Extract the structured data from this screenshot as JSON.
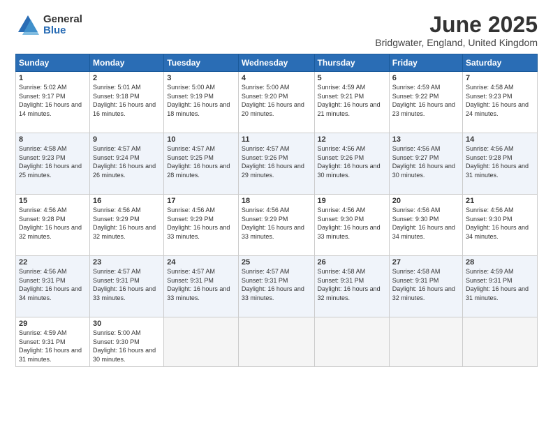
{
  "logo": {
    "general": "General",
    "blue": "Blue"
  },
  "title": "June 2025",
  "location": "Bridgwater, England, United Kingdom",
  "days_header": [
    "Sunday",
    "Monday",
    "Tuesday",
    "Wednesday",
    "Thursday",
    "Friday",
    "Saturday"
  ],
  "weeks": [
    [
      {
        "num": "1",
        "sunrise": "5:02 AM",
        "sunset": "9:17 PM",
        "daylight": "16 hours and 14 minutes."
      },
      {
        "num": "2",
        "sunrise": "5:01 AM",
        "sunset": "9:18 PM",
        "daylight": "16 hours and 16 minutes."
      },
      {
        "num": "3",
        "sunrise": "5:00 AM",
        "sunset": "9:19 PM",
        "daylight": "16 hours and 18 minutes."
      },
      {
        "num": "4",
        "sunrise": "5:00 AM",
        "sunset": "9:20 PM",
        "daylight": "16 hours and 20 minutes."
      },
      {
        "num": "5",
        "sunrise": "4:59 AM",
        "sunset": "9:21 PM",
        "daylight": "16 hours and 21 minutes."
      },
      {
        "num": "6",
        "sunrise": "4:59 AM",
        "sunset": "9:22 PM",
        "daylight": "16 hours and 23 minutes."
      },
      {
        "num": "7",
        "sunrise": "4:58 AM",
        "sunset": "9:23 PM",
        "daylight": "16 hours and 24 minutes."
      }
    ],
    [
      {
        "num": "8",
        "sunrise": "4:58 AM",
        "sunset": "9:23 PM",
        "daylight": "16 hours and 25 minutes."
      },
      {
        "num": "9",
        "sunrise": "4:57 AM",
        "sunset": "9:24 PM",
        "daylight": "16 hours and 26 minutes."
      },
      {
        "num": "10",
        "sunrise": "4:57 AM",
        "sunset": "9:25 PM",
        "daylight": "16 hours and 28 minutes."
      },
      {
        "num": "11",
        "sunrise": "4:57 AM",
        "sunset": "9:26 PM",
        "daylight": "16 hours and 29 minutes."
      },
      {
        "num": "12",
        "sunrise": "4:56 AM",
        "sunset": "9:26 PM",
        "daylight": "16 hours and 30 minutes."
      },
      {
        "num": "13",
        "sunrise": "4:56 AM",
        "sunset": "9:27 PM",
        "daylight": "16 hours and 30 minutes."
      },
      {
        "num": "14",
        "sunrise": "4:56 AM",
        "sunset": "9:28 PM",
        "daylight": "16 hours and 31 minutes."
      }
    ],
    [
      {
        "num": "15",
        "sunrise": "4:56 AM",
        "sunset": "9:28 PM",
        "daylight": "16 hours and 32 minutes."
      },
      {
        "num": "16",
        "sunrise": "4:56 AM",
        "sunset": "9:29 PM",
        "daylight": "16 hours and 32 minutes."
      },
      {
        "num": "17",
        "sunrise": "4:56 AM",
        "sunset": "9:29 PM",
        "daylight": "16 hours and 33 minutes."
      },
      {
        "num": "18",
        "sunrise": "4:56 AM",
        "sunset": "9:29 PM",
        "daylight": "16 hours and 33 minutes."
      },
      {
        "num": "19",
        "sunrise": "4:56 AM",
        "sunset": "9:30 PM",
        "daylight": "16 hours and 33 minutes."
      },
      {
        "num": "20",
        "sunrise": "4:56 AM",
        "sunset": "9:30 PM",
        "daylight": "16 hours and 34 minutes."
      },
      {
        "num": "21",
        "sunrise": "4:56 AM",
        "sunset": "9:30 PM",
        "daylight": "16 hours and 34 minutes."
      }
    ],
    [
      {
        "num": "22",
        "sunrise": "4:56 AM",
        "sunset": "9:31 PM",
        "daylight": "16 hours and 34 minutes."
      },
      {
        "num": "23",
        "sunrise": "4:57 AM",
        "sunset": "9:31 PM",
        "daylight": "16 hours and 33 minutes."
      },
      {
        "num": "24",
        "sunrise": "4:57 AM",
        "sunset": "9:31 PM",
        "daylight": "16 hours and 33 minutes."
      },
      {
        "num": "25",
        "sunrise": "4:57 AM",
        "sunset": "9:31 PM",
        "daylight": "16 hours and 33 minutes."
      },
      {
        "num": "26",
        "sunrise": "4:58 AM",
        "sunset": "9:31 PM",
        "daylight": "16 hours and 32 minutes."
      },
      {
        "num": "27",
        "sunrise": "4:58 AM",
        "sunset": "9:31 PM",
        "daylight": "16 hours and 32 minutes."
      },
      {
        "num": "28",
        "sunrise": "4:59 AM",
        "sunset": "9:31 PM",
        "daylight": "16 hours and 31 minutes."
      }
    ],
    [
      {
        "num": "29",
        "sunrise": "4:59 AM",
        "sunset": "9:31 PM",
        "daylight": "16 hours and 31 minutes."
      },
      {
        "num": "30",
        "sunrise": "5:00 AM",
        "sunset": "9:30 PM",
        "daylight": "16 hours and 30 minutes."
      },
      null,
      null,
      null,
      null,
      null
    ]
  ]
}
